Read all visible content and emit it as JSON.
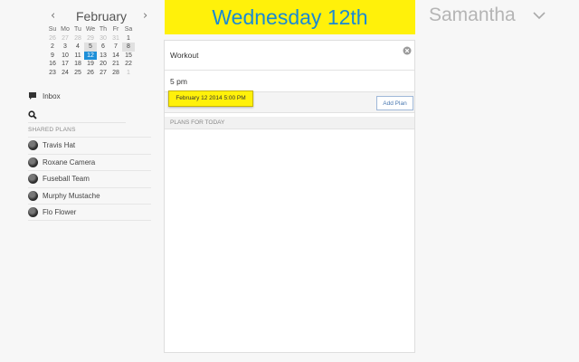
{
  "calendar": {
    "month": "February",
    "prev": "‹",
    "next": "›",
    "weekdays": [
      "Su",
      "Mo",
      "Tu",
      "We",
      "Th",
      "Fr",
      "Sa"
    ],
    "weeks": [
      [
        "26",
        "27",
        "28",
        "29",
        "30",
        "31",
        "1"
      ],
      [
        "2",
        "3",
        "4",
        "5",
        "6",
        "7",
        "8"
      ],
      [
        "9",
        "10",
        "11",
        "12",
        "13",
        "14",
        "15"
      ],
      [
        "16",
        "17",
        "18",
        "19",
        "20",
        "21",
        "22"
      ],
      [
        "23",
        "24",
        "25",
        "26",
        "27",
        "28",
        "1"
      ]
    ],
    "selected_day": "12"
  },
  "nav": {
    "inbox": "Inbox"
  },
  "search": {
    "placeholder": ""
  },
  "shared_plans": {
    "title": "SHARED PLANS",
    "items": [
      "Travis Hat",
      "Roxane Camera",
      "Fuseball Team",
      "Murphy Mustache",
      "Flo Flower"
    ]
  },
  "header": {
    "date": "Wednesday 12th",
    "user": "Samantha"
  },
  "plan_form": {
    "title": "Workout",
    "time_value": "5 pm",
    "suggestion": "February 12 2014 5:00 PM",
    "add_button": "Add Plan",
    "plans_header": "PLANS FOR TODAY"
  },
  "colors": {
    "banner": "#fff10a",
    "date_text": "#1a8ad4",
    "selected_day": "#1e8fd8"
  }
}
